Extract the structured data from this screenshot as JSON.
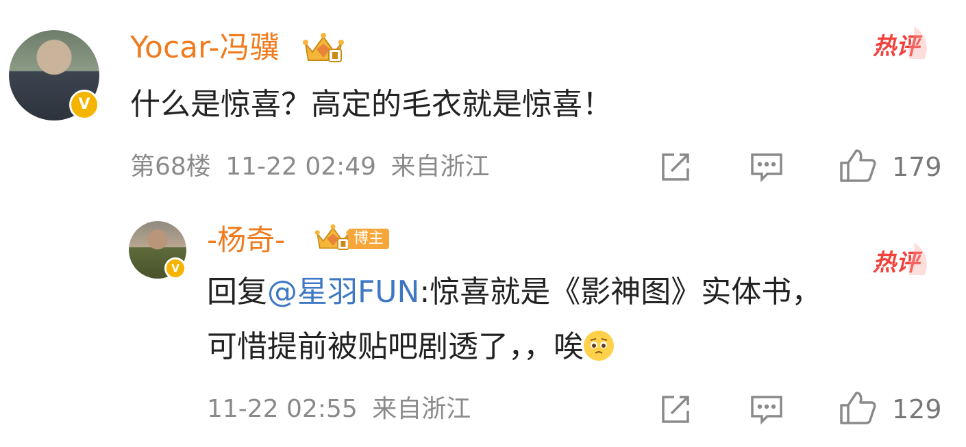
{
  "comments": [
    {
      "username": "Yocar-冯骥",
      "text": "什么是惊喜？高定的毛衣就是惊喜！",
      "floor": "第68楼",
      "time": "11-22 02:49",
      "location": "来自浙江",
      "hot_label": "热评",
      "like_count": "179",
      "badge_letter": "V"
    },
    {
      "username": "-杨奇-",
      "role_tag": "博主",
      "reply_prefix": "回复",
      "mention": "@星羽FUN",
      "text_line1": ":惊喜就是《影神图》实体书，",
      "text_line2": "可惜提前被贴吧剧透了，，唉",
      "time": "11-22 02:55",
      "location": "来自浙江",
      "hot_label": "热评",
      "like_count": "129",
      "badge_letter": "V"
    }
  ],
  "colors": {
    "username": "#f07b1e",
    "mention": "#3e78c5",
    "hot": "#f0413c",
    "verify_badge": "#f5b400"
  }
}
